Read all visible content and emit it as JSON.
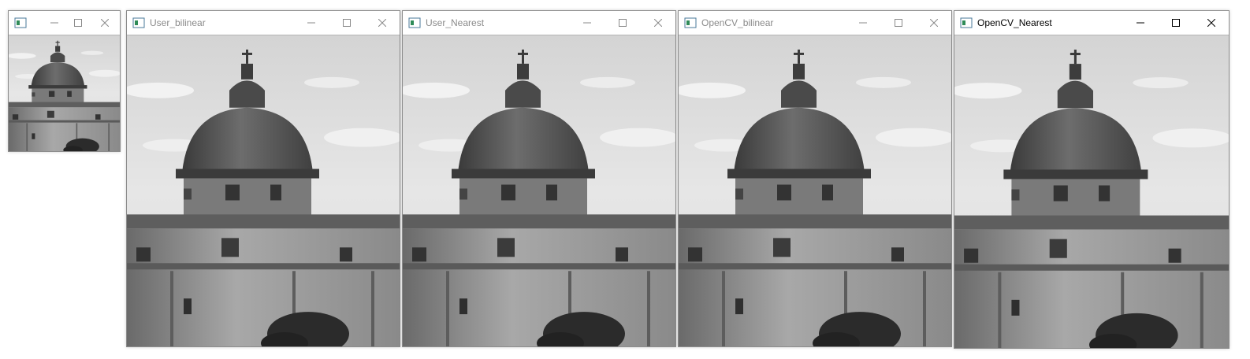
{
  "windows": [
    {
      "id": "original",
      "title": "",
      "active": false
    },
    {
      "id": "user-bilinear",
      "title": "User_bilinear",
      "active": false
    },
    {
      "id": "user-nearest",
      "title": "User_Nearest",
      "active": false
    },
    {
      "id": "opencv-bilinear",
      "title": "OpenCV_bilinear",
      "active": false
    },
    {
      "id": "opencv-nearest",
      "title": "OpenCV_Nearest",
      "active": true
    }
  ],
  "icons": {
    "app": "opencv-window-icon",
    "minimize": "minimize-icon",
    "maximize": "maximize-icon",
    "close": "close-icon"
  },
  "colors": {
    "inactive_title": "#8a8a8a",
    "active_title": "#000000",
    "border": "#8c8c8c"
  }
}
